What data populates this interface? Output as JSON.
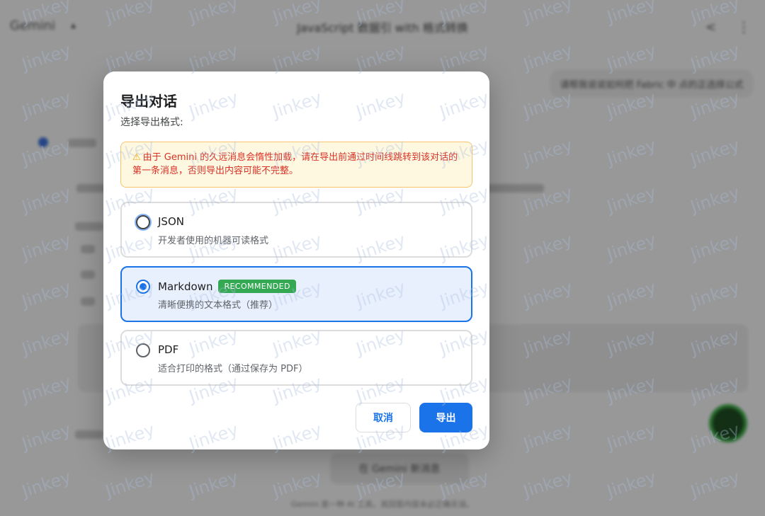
{
  "background": {
    "app_name": "Gemini",
    "conversation_title": "JavaScript 数据引 with 格式转换",
    "user_message": "请帮我说说如何把 Fabric 中 点的正选择公式",
    "new_chat_label": "在 Gemini 新消息",
    "footer": "Gemini 是一种 AI 工具，其回答内容未必正确无误。"
  },
  "dialog": {
    "title": "导出对话",
    "subtitle": "选择导出格式:",
    "warning": "由于 Gemini 的久远消息会惰性加载，请在导出前通过时间线跳转到该对话的第一条消息，否则导出内容可能不完整。",
    "warning_icon": "⚠",
    "options": [
      {
        "label": "JSON",
        "description": "开发者使用的机器可读格式",
        "selected": false
      },
      {
        "label": "Markdown",
        "badge": "RECOMMENDED",
        "description": "清晰便携的文本格式（推荐）",
        "selected": true
      },
      {
        "label": "PDF",
        "description": "适合打印的格式（通过保存为 PDF）",
        "selected": false
      }
    ],
    "cancel_label": "取消",
    "export_label": "导出"
  },
  "watermark_text": "Jinkey",
  "colors": {
    "accent": "#1a73e8",
    "selected_bg": "#e8f0fe",
    "badge": "#34a853",
    "warning_bg": "#fff8e1",
    "warning_border": "#f6c36a",
    "warning_text": "#d93025"
  }
}
